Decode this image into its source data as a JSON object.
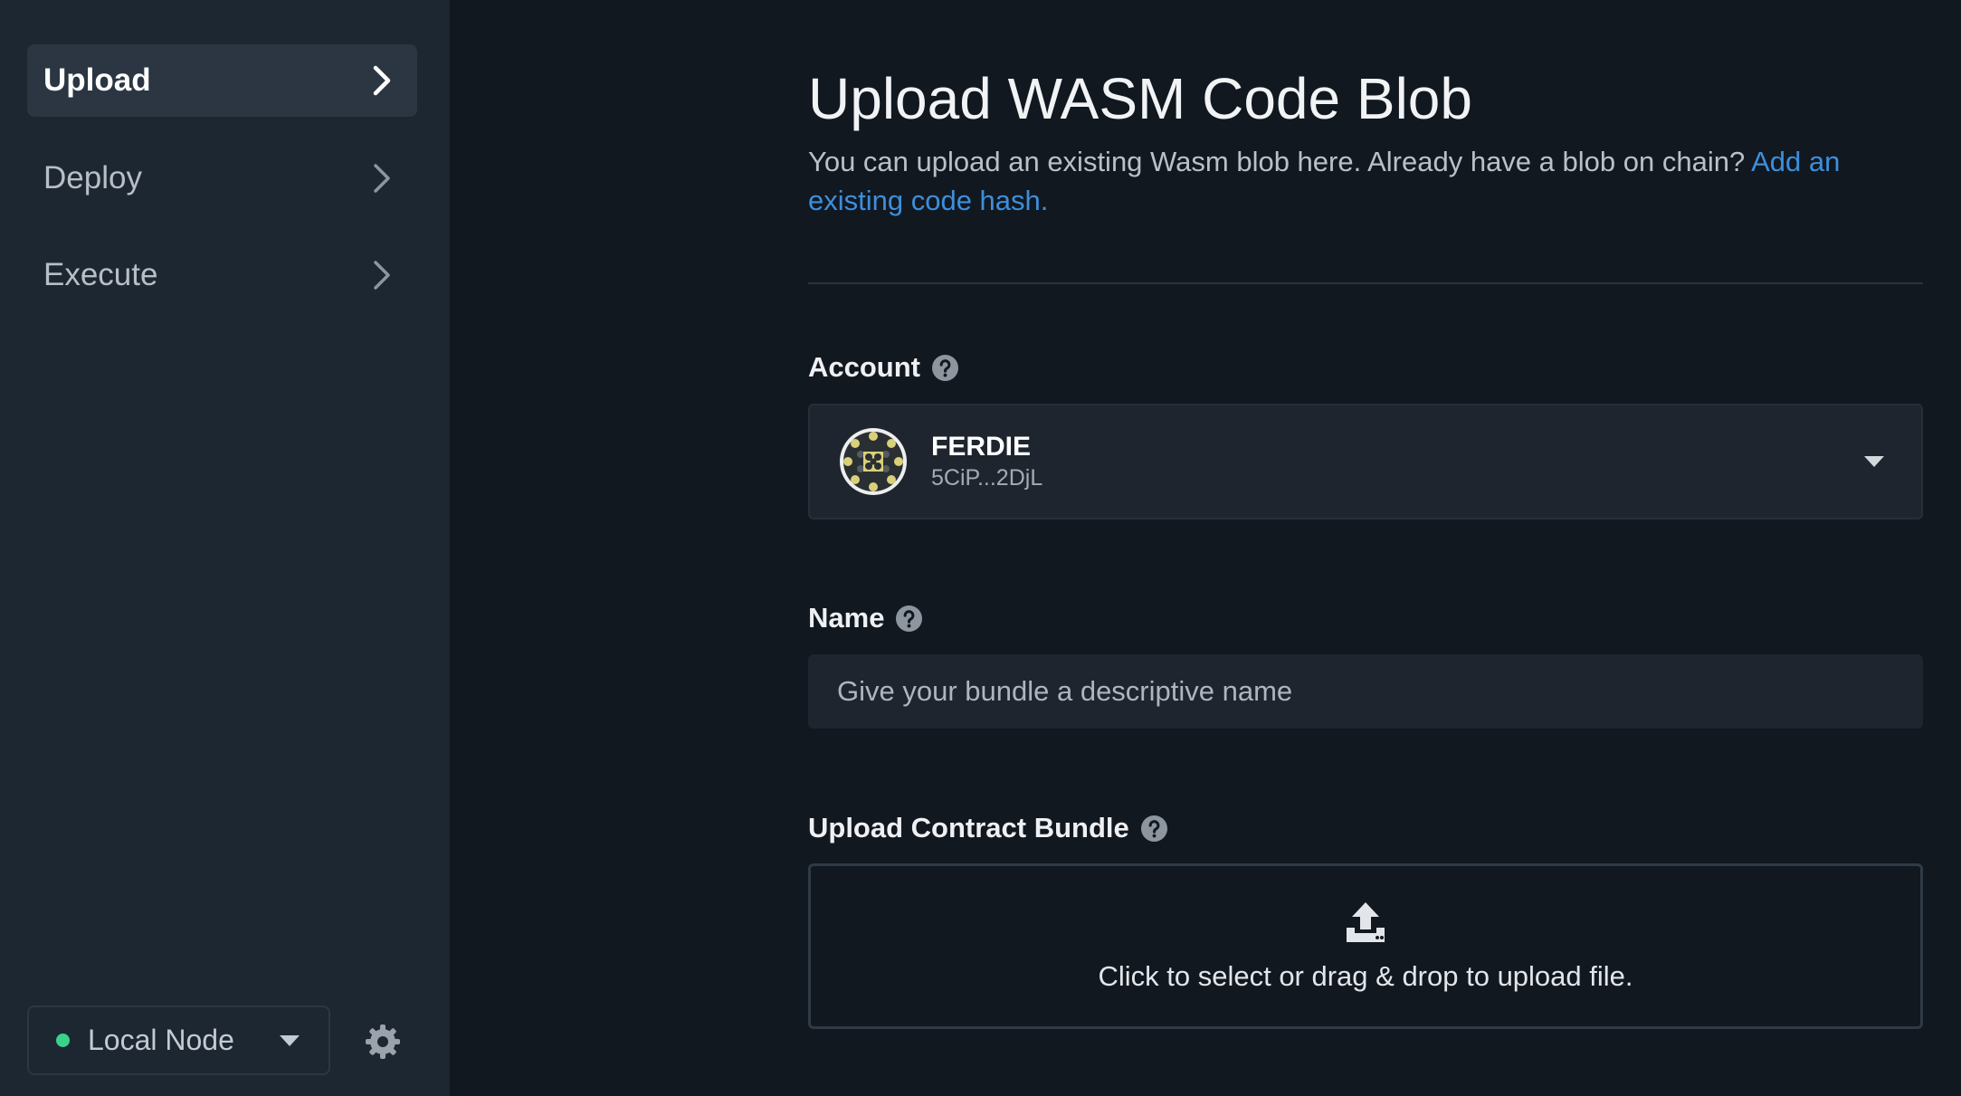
{
  "sidebar": {
    "items": [
      {
        "label": "Upload",
        "active": true
      },
      {
        "label": "Deploy",
        "active": false
      },
      {
        "label": "Execute",
        "active": false
      }
    ],
    "node": {
      "label": "Local Node",
      "status_color": "#3ad28a"
    }
  },
  "main": {
    "title": "Upload WASM Code Blob",
    "subtitle": "You can upload an existing Wasm blob here. Already have a blob on chain?",
    "subtitle_link": "Add an existing code hash.",
    "account": {
      "label": "Account",
      "name": "FERDIE",
      "address": "5CiP...2DjL"
    },
    "name_field": {
      "label": "Name",
      "placeholder": "Give your bundle a descriptive name",
      "value": ""
    },
    "bundle": {
      "label": "Upload Contract Bundle",
      "dropzone_text": "Click to select or drag & drop to upload file."
    }
  },
  "colors": {
    "link": "#3d8fdb",
    "sidebar_bg": "#1d2732",
    "page_bg": "#121820"
  },
  "icons": [
    "chevron-right-icon",
    "caret-down-icon",
    "gear-icon",
    "help-circle-icon",
    "identicon",
    "upload-icon",
    "status-dot"
  ]
}
